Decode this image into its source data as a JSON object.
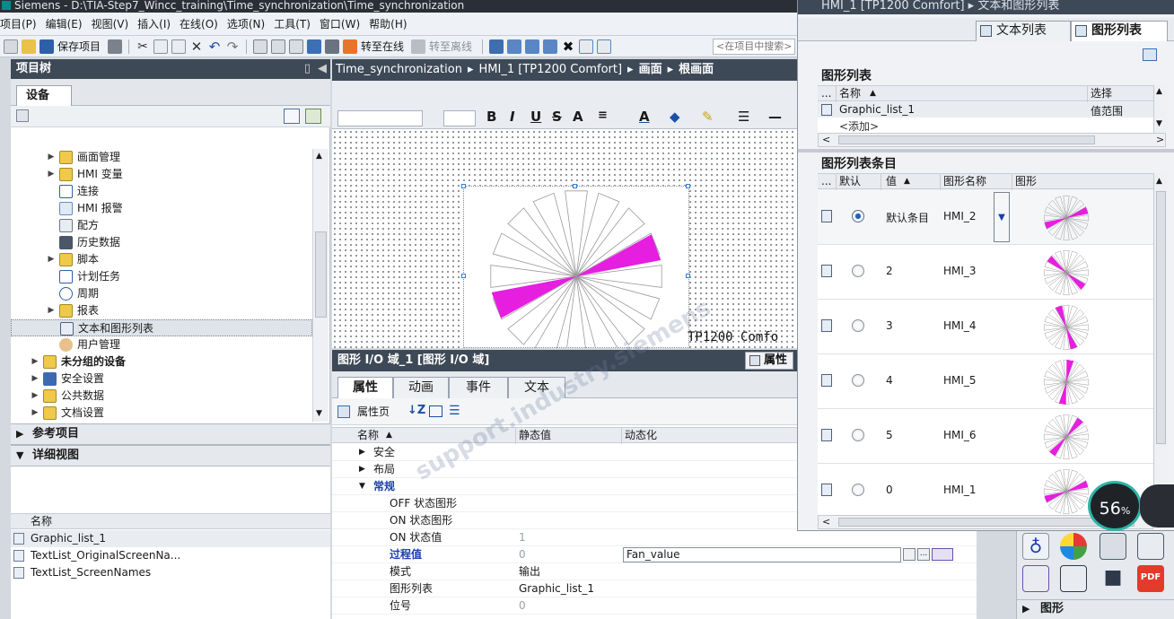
{
  "window": {
    "title": "Siemens  -  D:\\TIA-Step7_Wincc_training\\Time_synchronization\\Time_synchronization"
  },
  "menu": {
    "items": [
      "项目(P)",
      "编辑(E)",
      "视图(V)",
      "插入(I)",
      "在线(O)",
      "选项(N)",
      "工具(T)",
      "窗口(W)",
      "帮助(H)"
    ]
  },
  "toolbar": {
    "save_project": "保存项目",
    "go_online": "转至在线",
    "go_offline": "转至离线",
    "search_placeholder": "<在项目中搜索>"
  },
  "project_tree": {
    "title": "项目树",
    "tab": "设备",
    "items": [
      {
        "label": "画面管理",
        "expand": "▶"
      },
      {
        "label": "HMI 变量",
        "expand": "▶"
      },
      {
        "label": "连接",
        "expand": ""
      },
      {
        "label": "HMI 报警",
        "expand": ""
      },
      {
        "label": "配方",
        "expand": ""
      },
      {
        "label": "历史数据",
        "expand": ""
      },
      {
        "label": "脚本",
        "expand": "▶"
      },
      {
        "label": "计划任务",
        "expand": ""
      },
      {
        "label": "周期",
        "expand": ""
      },
      {
        "label": "报表",
        "expand": "▶"
      },
      {
        "label": "文本和图形列表",
        "expand": ""
      },
      {
        "label": "用户管理",
        "expand": ""
      },
      {
        "label": "未分组的设备",
        "expand": "▶"
      },
      {
        "label": "安全设置",
        "expand": "▶"
      },
      {
        "label": "公共数据",
        "expand": "▶"
      },
      {
        "label": "文档设置",
        "expand": "▶"
      }
    ]
  },
  "reference": {
    "title": "参考项目"
  },
  "detail_view": {
    "title": "详细视图",
    "col_name": "名称",
    "rows": [
      "Graphic_list_1",
      "TextList_OriginalScreenNa...",
      "TextList_ScreenNames"
    ]
  },
  "editor": {
    "breadcrumb": [
      "Time_synchronization",
      "HMI_1 [TP1200 Comfort]",
      "画面",
      "根画面"
    ],
    "device_label": "TP1200 Comfo"
  },
  "properties": {
    "title": "图形 I/O 域_1 [图形 I/O 域]",
    "panel_tab": "属性",
    "tabs": [
      "属性",
      "动画",
      "事件",
      "文本"
    ],
    "tool_label": "属性页",
    "headers": {
      "name": "名称",
      "static": "静态值",
      "dynamic": "动态化"
    },
    "groups": [
      "安全",
      "布局",
      "常规"
    ],
    "rows": [
      {
        "name": "OFF 状态图形",
        "value": ""
      },
      {
        "name": "ON 状态图形",
        "value": ""
      },
      {
        "name": "ON 状态值",
        "value": "1"
      },
      {
        "name": "过程值",
        "value": "0",
        "dynamic": "Fan_value"
      },
      {
        "name": "模式",
        "value": "输出"
      },
      {
        "name": "图形列表",
        "value": "Graphic_list_1"
      },
      {
        "name": "位号",
        "value": "0"
      }
    ]
  },
  "graphic_window": {
    "title": "HMI_1 [TP1200 Comfort]  ▸  文本和图形列表",
    "tabs": [
      "文本列表",
      "图形列表"
    ],
    "list_section": "图形列表",
    "list_headers": {
      "dots": "...",
      "name": "名称",
      "select": "选择"
    },
    "list_rows": [
      {
        "name": "Graphic_list_1",
        "select": "值范围"
      }
    ],
    "add_row": "<添加>",
    "entries_section": "图形列表条目",
    "entry_headers": {
      "dots": "...",
      "default": "默认",
      "value": "值",
      "gname": "图形名称",
      "graphic": "图形"
    },
    "entries": [
      {
        "value": "默认条目",
        "name": "HMI_2",
        "default": true,
        "angle": 0
      },
      {
        "value": "2",
        "name": "HMI_3",
        "default": false,
        "angle": 60
      },
      {
        "value": "3",
        "name": "HMI_4",
        "default": false,
        "angle": 90
      },
      {
        "value": "4",
        "name": "HMI_5",
        "default": false,
        "angle": 120
      },
      {
        "value": "5",
        "name": "HMI_6",
        "default": false,
        "angle": 150
      },
      {
        "value": "0",
        "name": "HMI_1",
        "default": false,
        "angle": 180
      }
    ]
  },
  "right_bottom": {
    "section": "图形"
  },
  "perf": {
    "value": "56",
    "unit": "%"
  },
  "colors": {
    "accent": "#e61ee0",
    "panel_title": "#3e4957",
    "selection_blue": "#1f5fbf"
  }
}
